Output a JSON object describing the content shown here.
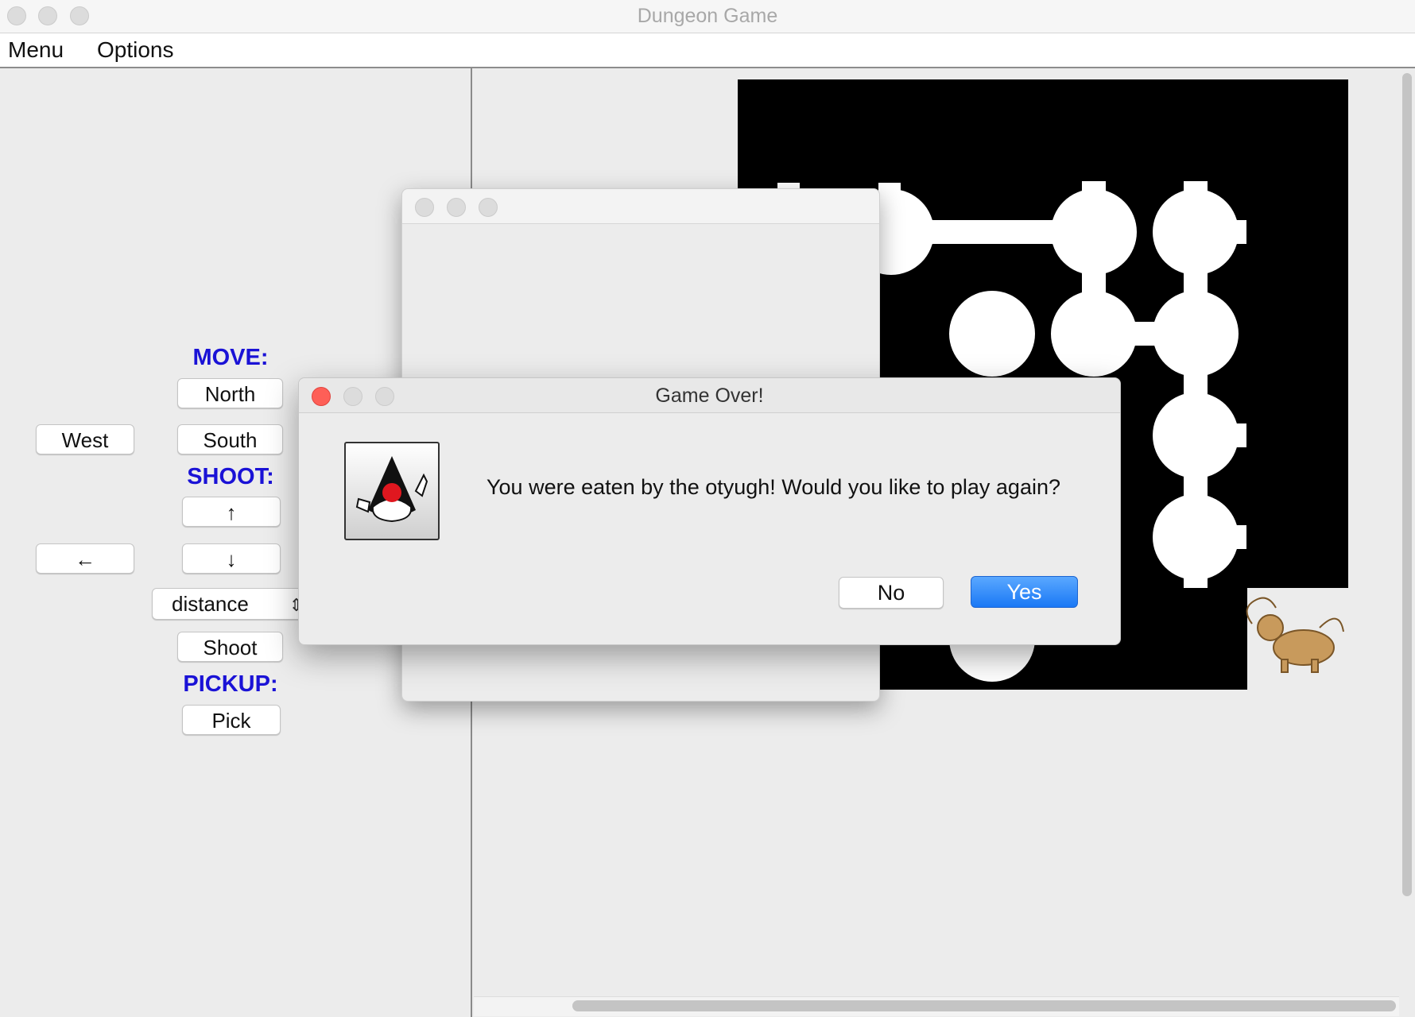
{
  "window": {
    "title": "Dungeon Game"
  },
  "menubar": {
    "items": [
      "Menu",
      "Options"
    ]
  },
  "controls": {
    "move_label": "MOVE:",
    "north": "North",
    "west": "West",
    "south": "South",
    "shoot_label": "SHOOT:",
    "up_arrow": "↑",
    "left_arrow": "←",
    "down_arrow": "↓",
    "distance_select": "distance",
    "shoot_button": "Shoot",
    "pickup_label": "PICKUP:",
    "pick_button": "Pick"
  },
  "dialog": {
    "title": "Game Over!",
    "message": "You were eaten by the otyugh! Would you like to play again?",
    "no_button": "No",
    "yes_button": "Yes",
    "icon": "java-duke-icon"
  },
  "colors": {
    "section_label": "#1a12d6",
    "default_button": "#1a78f5",
    "close_button": "#fe5f57"
  }
}
